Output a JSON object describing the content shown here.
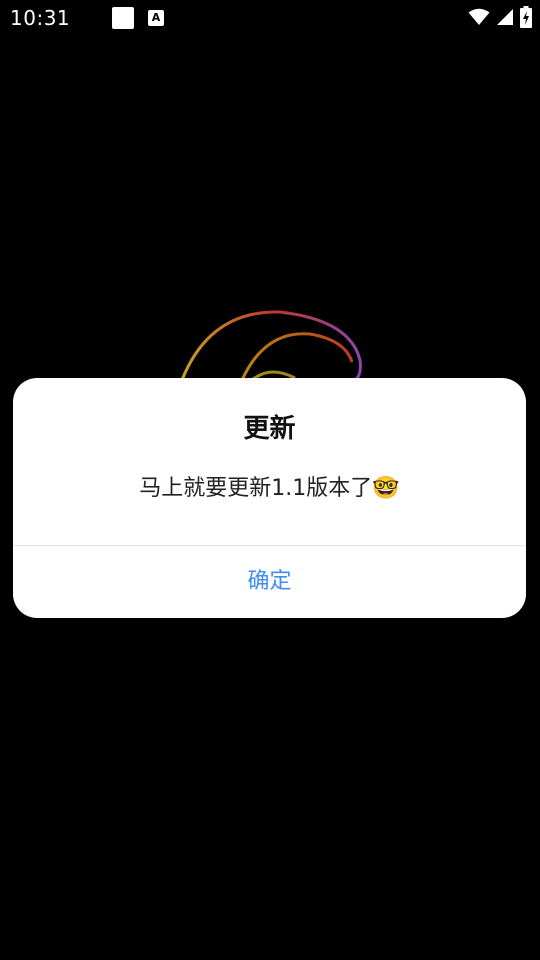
{
  "status_bar": {
    "time": "10:31",
    "notification_badge_letter": "A",
    "icons": [
      "wifi-icon",
      "cell-signal-icon",
      "battery-charging-icon"
    ]
  },
  "dialog": {
    "title": "更新",
    "message": "马上就要更新1.1版本了🤓",
    "confirm_label": "确定"
  },
  "colors": {
    "background": "#000000",
    "dialog_background": "#ffffff",
    "accent": "#3f8ef0"
  }
}
